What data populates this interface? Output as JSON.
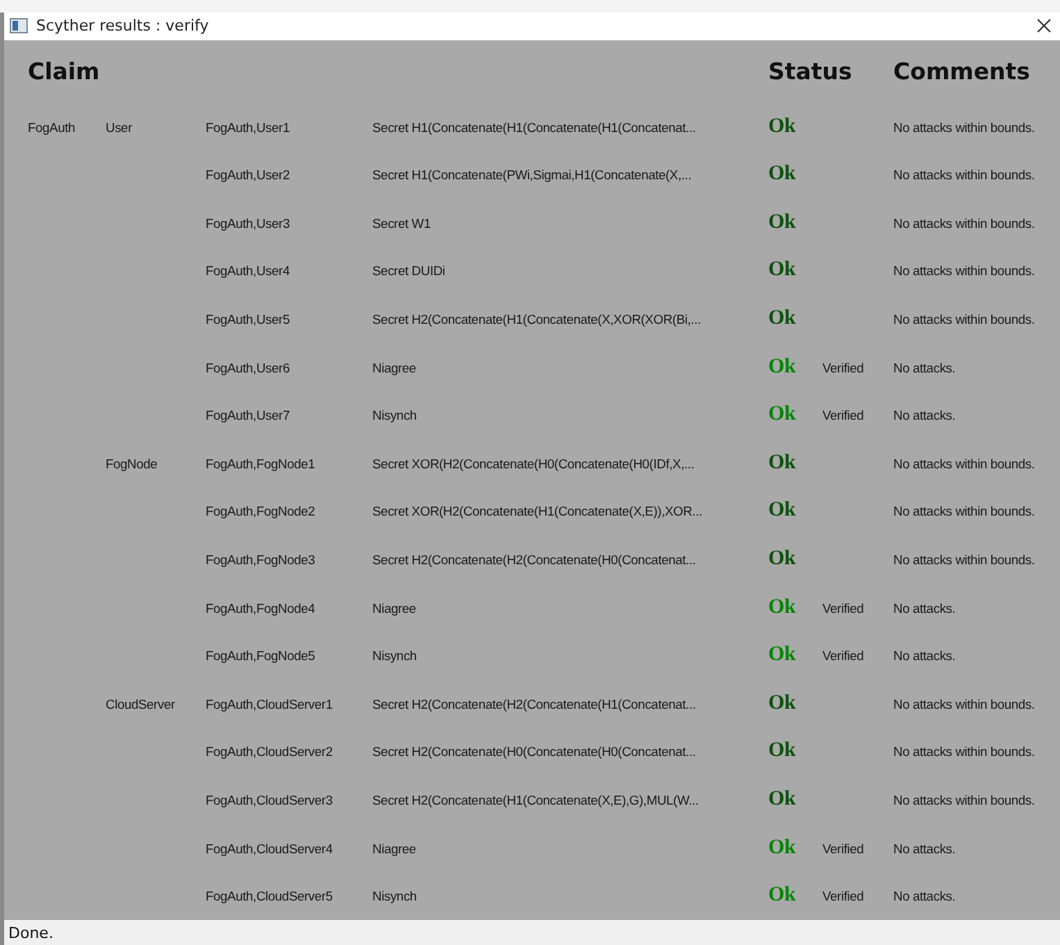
{
  "window": {
    "title": "Scyther results : verify"
  },
  "header": {
    "claim": "Claim",
    "status": "Status",
    "comments": "Comments"
  },
  "rows": [
    {
      "protocol": "FogAuth",
      "role": "User",
      "label": "FogAuth,User1",
      "claim": "Secret H1(Concatenate(H1(Concatenate(H1(Concatenat...",
      "status": "Ok",
      "kind": "bounded",
      "comment": "No attacks within bounds."
    },
    {
      "label": "FogAuth,User2",
      "claim": "Secret H1(Concatenate(PWi,Sigmai,H1(Concatenate(X,...",
      "status": "Ok",
      "kind": "bounded",
      "comment": "No attacks within bounds."
    },
    {
      "label": "FogAuth,User3",
      "claim": "Secret W1",
      "status": "Ok",
      "kind": "bounded",
      "comment": "No attacks within bounds."
    },
    {
      "label": "FogAuth,User4",
      "claim": "Secret DUIDi",
      "status": "Ok",
      "kind": "bounded",
      "comment": "No attacks within bounds."
    },
    {
      "label": "FogAuth,User5",
      "claim": "Secret H2(Concatenate(H1(Concatenate(X,XOR(XOR(Bi,...",
      "status": "Ok",
      "kind": "bounded",
      "comment": "No attacks within bounds."
    },
    {
      "label": "FogAuth,User6",
      "claim": "Niagree",
      "status": "Ok",
      "kind": "verified",
      "verdict": "Verified",
      "comment": "No attacks."
    },
    {
      "label": "FogAuth,User7",
      "claim": "Nisynch",
      "status": "Ok",
      "kind": "verified",
      "verdict": "Verified",
      "comment": "No attacks."
    },
    {
      "role": "FogNode",
      "label": "FogAuth,FogNode1",
      "claim": "Secret XOR(H2(Concatenate(H0(Concatenate(H0(IDf,X,...",
      "status": "Ok",
      "kind": "bounded",
      "comment": "No attacks within bounds."
    },
    {
      "label": "FogAuth,FogNode2",
      "claim": "Secret XOR(H2(Concatenate(H1(Concatenate(X,E)),XOR...",
      "status": "Ok",
      "kind": "bounded",
      "comment": "No attacks within bounds."
    },
    {
      "label": "FogAuth,FogNode3",
      "claim": "Secret H2(Concatenate(H2(Concatenate(H0(Concatenat...",
      "status": "Ok",
      "kind": "bounded",
      "comment": "No attacks within bounds."
    },
    {
      "label": "FogAuth,FogNode4",
      "claim": "Niagree",
      "status": "Ok",
      "kind": "verified",
      "verdict": "Verified",
      "comment": "No attacks."
    },
    {
      "label": "FogAuth,FogNode5",
      "claim": "Nisynch",
      "status": "Ok",
      "kind": "verified",
      "verdict": "Verified",
      "comment": "No attacks."
    },
    {
      "role": "CloudServer",
      "label": "FogAuth,CloudServer1",
      "claim": "Secret H2(Concatenate(H2(Concatenate(H1(Concatenat...",
      "status": "Ok",
      "kind": "bounded",
      "comment": "No attacks within bounds."
    },
    {
      "label": "FogAuth,CloudServer2",
      "claim": "Secret H2(Concatenate(H0(Concatenate(H0(Concatenat...",
      "status": "Ok",
      "kind": "bounded",
      "comment": "No attacks within bounds."
    },
    {
      "label": "FogAuth,CloudServer3",
      "claim": "Secret H2(Concatenate(H1(Concatenate(X,E),G),MUL(W...",
      "status": "Ok",
      "kind": "bounded",
      "comment": "No attacks within bounds."
    },
    {
      "label": "FogAuth,CloudServer4",
      "claim": "Niagree",
      "status": "Ok",
      "kind": "verified",
      "verdict": "Verified",
      "comment": "No attacks."
    },
    {
      "label": "FogAuth,CloudServer5",
      "claim": "Nisynch",
      "status": "Ok",
      "kind": "verified",
      "verdict": "Verified",
      "comment": "No attacks."
    }
  ],
  "status_bar": "Done."
}
